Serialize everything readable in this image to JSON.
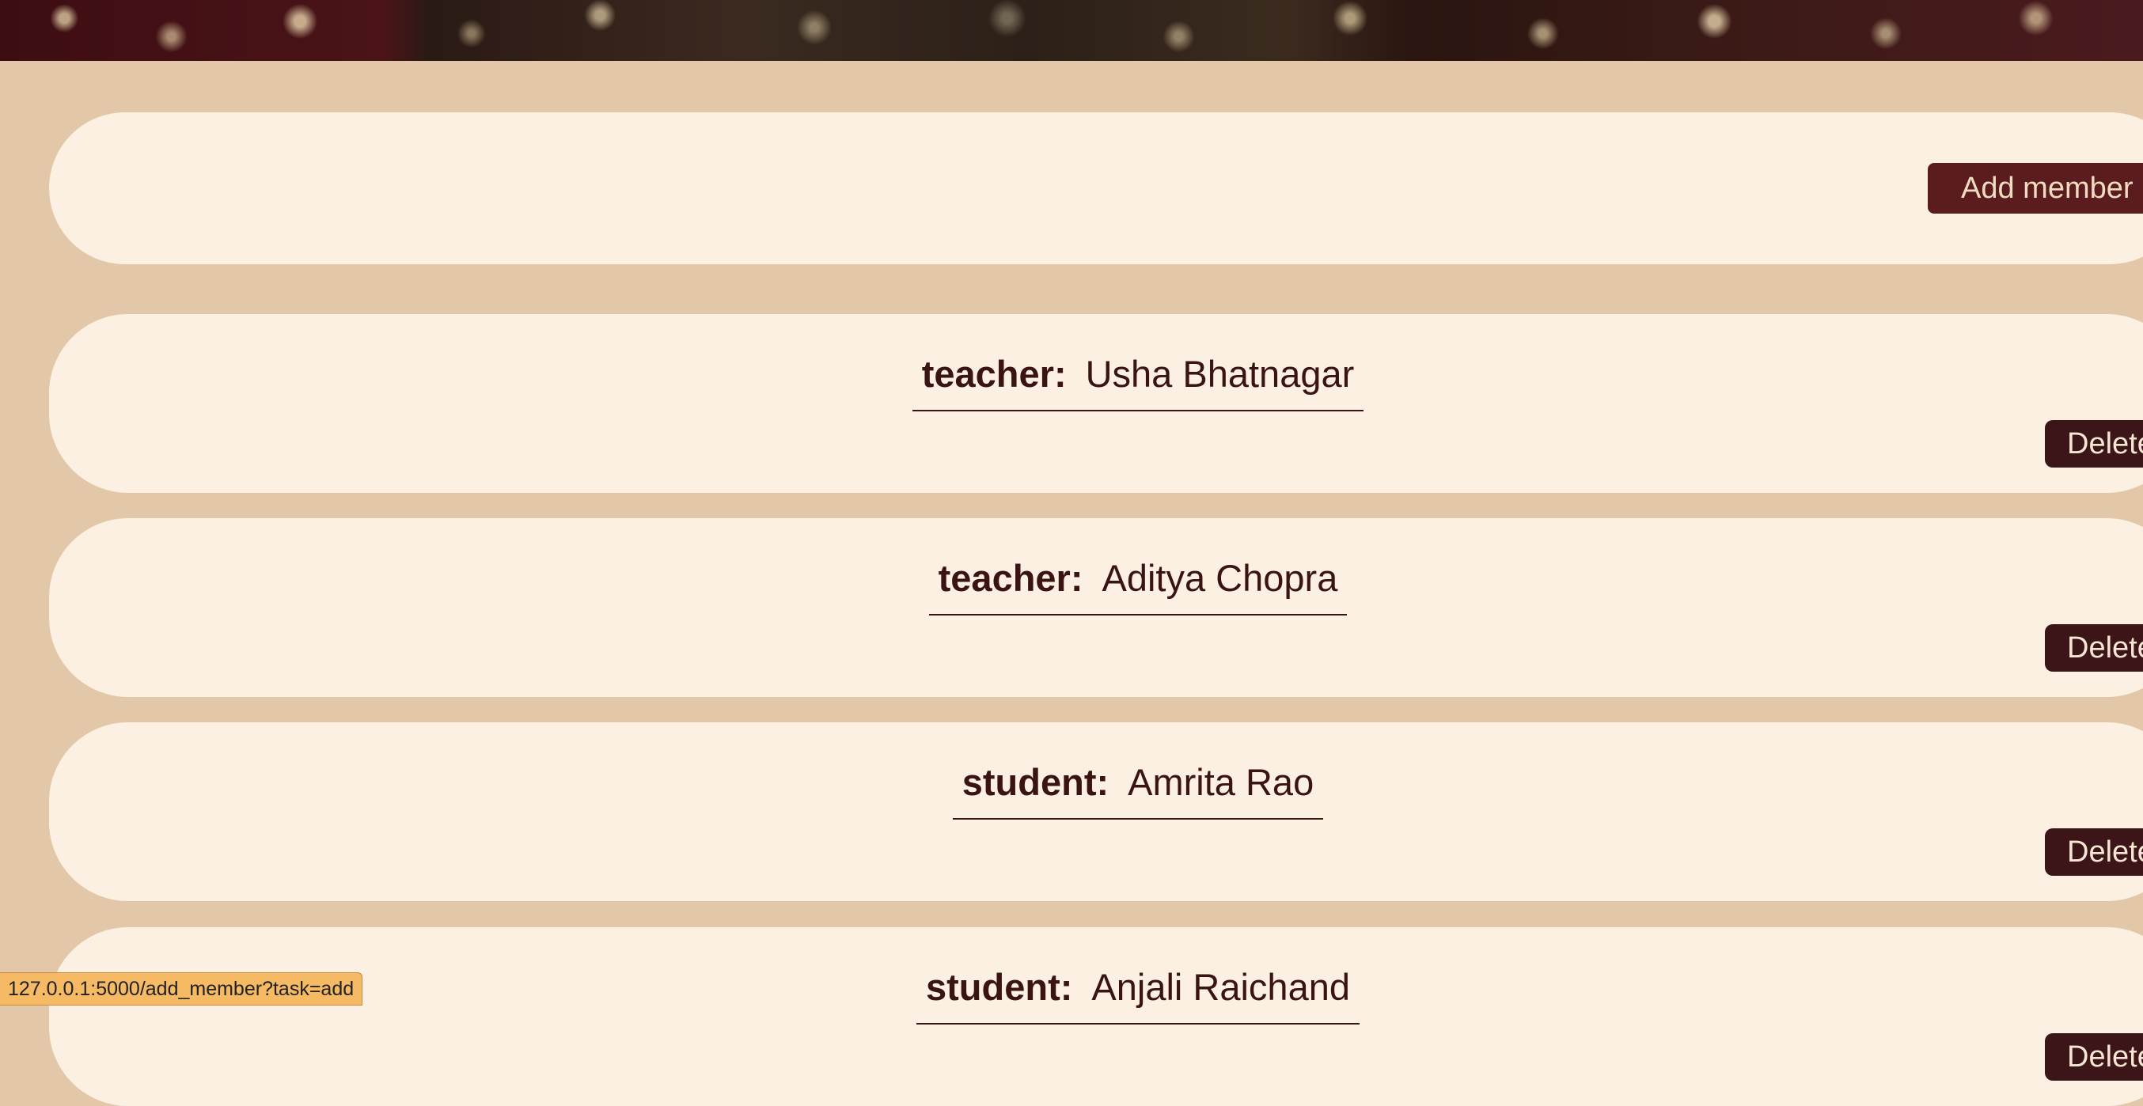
{
  "add_section": {
    "add_label": "Add member"
  },
  "members": [
    {
      "role": "teacher:",
      "name": "Usha Bhatnagar",
      "delete_label": "Delete"
    },
    {
      "role": "teacher:",
      "name": "Aditya Chopra",
      "delete_label": "Delete"
    },
    {
      "role": "student:",
      "name": "Amrita Rao",
      "delete_label": "Delete"
    },
    {
      "role": "student:",
      "name": "Anjali Raichand",
      "delete_label": "Delete"
    }
  ],
  "status_bar": {
    "url": "127.0.0.1:5000/add_member?task=add"
  },
  "colors": {
    "page_background": "#e3c7a9",
    "card_background": "#fcf0e2",
    "add_button": "#5a1c1e",
    "delete_button": "#3b1517",
    "text": "#3a1410"
  }
}
